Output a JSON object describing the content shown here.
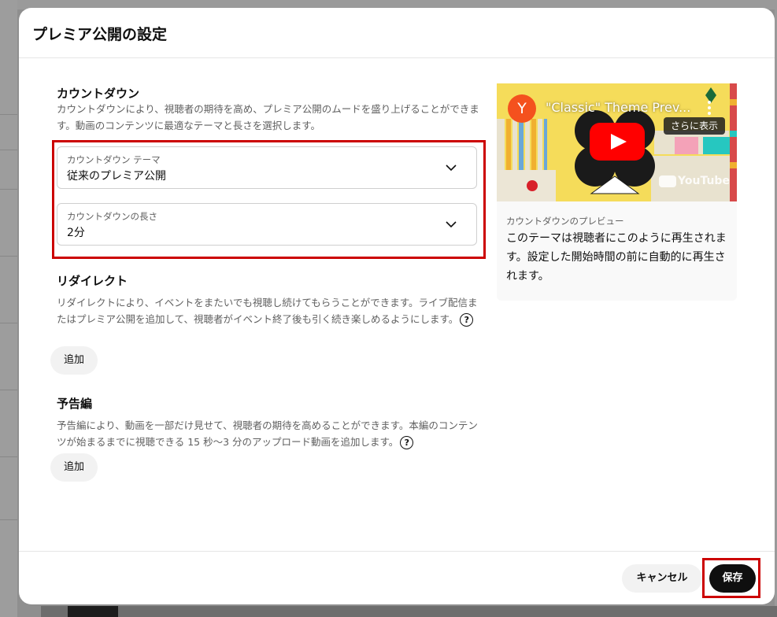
{
  "dialog": {
    "title": "プレミア公開の設定"
  },
  "countdown": {
    "title": "カウントダウン",
    "desc": "カウントダウンにより、視聴者の期待を高め、プレミア公開のムードを盛り上げることができます。動画のコンテンツに最適なテーマと長さを選択します。",
    "theme_label": "カウントダウン テーマ",
    "theme_value": "従来のプレミア公開",
    "length_label": "カウントダウンの長さ",
    "length_value": "2分"
  },
  "redirect": {
    "title": "リダイレクト",
    "desc": "リダイレクトにより、イベントをまたいでも視聴し続けてもらうことができます。ライブ配信またはプレミア公開を追加して、視聴者がイベント終了後も引く続き楽しめるようにします。",
    "add_label": "追加"
  },
  "trailer": {
    "title": "予告編",
    "desc": "予告編により、動画を一部だけ見せて、視聴者の期待を高めることができます。本編のコンテンツが始まるまでに視聴できる 15 秒〜3 分のアップロード動画を追加します。",
    "add_label": "追加"
  },
  "preview": {
    "channel_initial": "Y",
    "video_title": "\"Classic\" Theme Prev...",
    "more_label": "さらに表示",
    "youtube_label": "YouTube",
    "caption_label": "カウントダウンのプレビュー",
    "caption_text": "このテーマは視聴者にこのように再生されます。設定した開始時間の前に自動的に再生されます。"
  },
  "footer": {
    "cancel_label": "キャンセル",
    "save_label": "保存"
  },
  "colors": {
    "highlight": "#cc0000",
    "avatar": "#f4511e",
    "play_button": "#ff0000"
  }
}
